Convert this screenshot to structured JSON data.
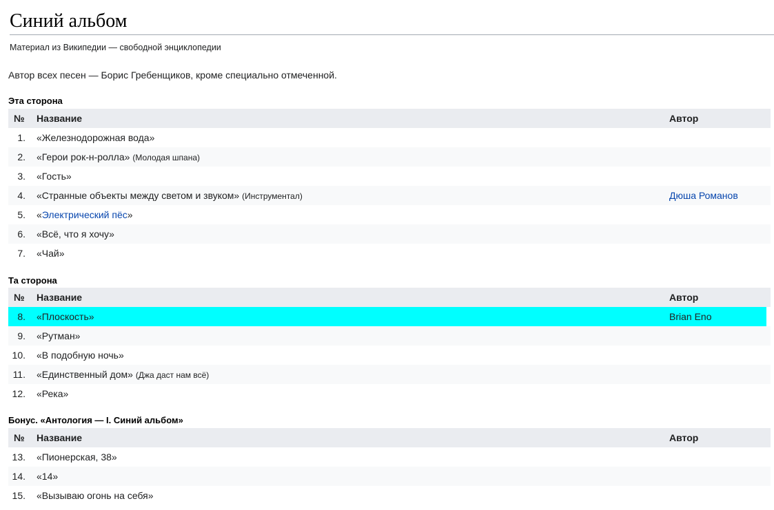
{
  "article": {
    "title": "Синий альбом",
    "tagline": "Материал из Википедии — свободной энциклопедии",
    "intro": "Автор всех песен — Борис Гребенщиков, кроме специально отмеченной."
  },
  "colors": {
    "link": "#0645ad",
    "highlight": "#00ffff",
    "header_bg": "#eaecf0",
    "alt_row_bg": "#f8f9fa"
  },
  "sections": [
    {
      "title": "Эта сторона",
      "headers": {
        "num": "№",
        "name": "Название",
        "author": "Автор"
      },
      "tracks": [
        {
          "num": "1.",
          "prefix": "«Железнодорожная вода»",
          "link": "",
          "suffix": "",
          "note": "",
          "author": ""
        },
        {
          "num": "2.",
          "prefix": "«Герои рок-н-ролла»",
          "link": "",
          "suffix": "",
          "note": "(Молодая шпана)",
          "author": ""
        },
        {
          "num": "3.",
          "prefix": "«Гость»",
          "link": "",
          "suffix": "",
          "note": "",
          "author": ""
        },
        {
          "num": "4.",
          "prefix": "«Странные объекты между светом и звуком»",
          "link": "",
          "suffix": "",
          "note": "(Инструментал)",
          "author": "Дюша Романов"
        },
        {
          "num": "5.",
          "prefix": "«",
          "link": "Электрический пёс",
          "suffix": "»",
          "note": "",
          "author": ""
        },
        {
          "num": "6.",
          "prefix": "«Всё, что я хочу»",
          "link": "",
          "suffix": "",
          "note": "",
          "author": ""
        },
        {
          "num": "7.",
          "prefix": "«Чай»",
          "link": "",
          "suffix": "",
          "note": "",
          "author": ""
        }
      ]
    },
    {
      "title": "Та сторона",
      "headers": {
        "num": "№",
        "name": "Название",
        "author": "Автор"
      },
      "tracks": [
        {
          "num": "8.",
          "prefix": "«Плоскость»",
          "link": "",
          "suffix": "",
          "note": "",
          "author": "Brian Eno",
          "highlighted": true
        },
        {
          "num": "9.",
          "prefix": "«Рутман»",
          "link": "",
          "suffix": "",
          "note": "",
          "author": ""
        },
        {
          "num": "10.",
          "prefix": "«В подобную ночь»",
          "link": "",
          "suffix": "",
          "note": "",
          "author": ""
        },
        {
          "num": "11.",
          "prefix": "«Единственный дом»",
          "link": "",
          "suffix": "",
          "note": "(Джа даст нам всё)",
          "author": ""
        },
        {
          "num": "12.",
          "prefix": "«Река»",
          "link": "",
          "suffix": "",
          "note": "",
          "author": ""
        }
      ]
    },
    {
      "title": "Бонус. «Антология — I. Синий альбом»",
      "headers": {
        "num": "№",
        "name": "Название",
        "author": "Автор"
      },
      "tracks": [
        {
          "num": "13.",
          "prefix": "«Пионерская, 38»",
          "link": "",
          "suffix": "",
          "note": "",
          "author": ""
        },
        {
          "num": "14.",
          "prefix": "«14»",
          "link": "",
          "suffix": "",
          "note": "",
          "author": ""
        },
        {
          "num": "15.",
          "prefix": "«Вызываю огонь на себя»",
          "link": "",
          "suffix": "",
          "note": "",
          "author": ""
        }
      ]
    }
  ]
}
